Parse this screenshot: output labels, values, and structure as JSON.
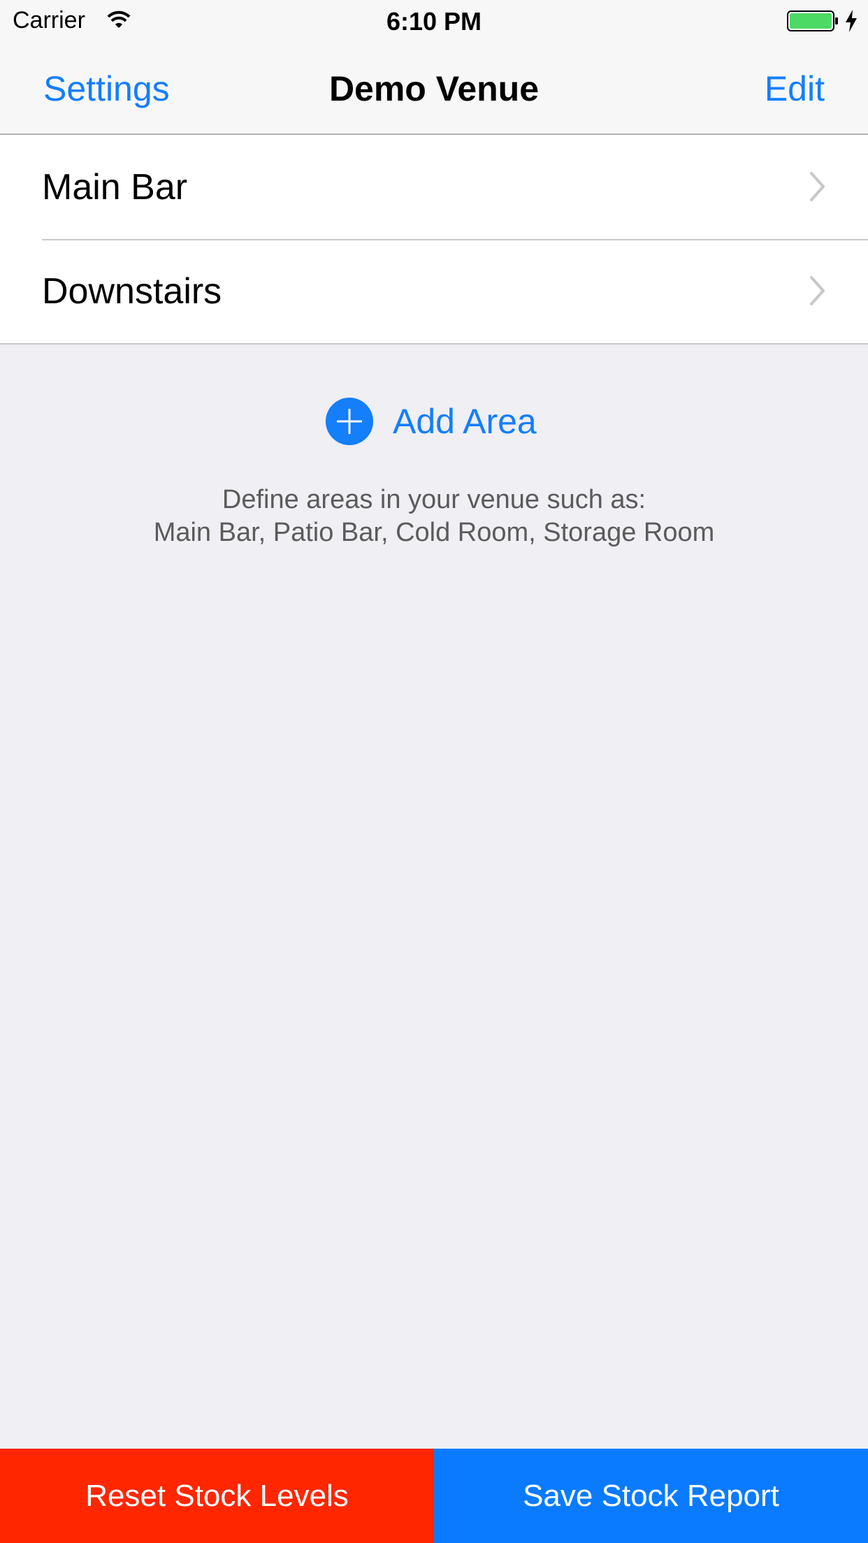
{
  "status_bar": {
    "carrier": "Carrier",
    "time": "6:10 PM",
    "battery_color": "#4cd964",
    "icons": [
      "wifi-icon",
      "battery-icon",
      "charging-bolt-icon"
    ]
  },
  "nav": {
    "left_label": "Settings",
    "title": "Demo Venue",
    "right_label": "Edit",
    "accent_color": "#147efb"
  },
  "areas": [
    {
      "label": "Main Bar",
      "icon": "chevron-right-icon"
    },
    {
      "label": "Downstairs",
      "icon": "chevron-right-icon"
    }
  ],
  "add_area": {
    "label": "Add Area",
    "icon": "plus-circle-icon"
  },
  "hint": {
    "line1": "Define areas in your venue such as:",
    "line2": "Main Bar, Patio Bar, Cold Room, Storage Room"
  },
  "bottom_actions": {
    "reset_label": "Reset Stock Levels",
    "reset_color": "#ff2600",
    "save_label": "Save Stock Report",
    "save_color": "#0a7bff"
  }
}
